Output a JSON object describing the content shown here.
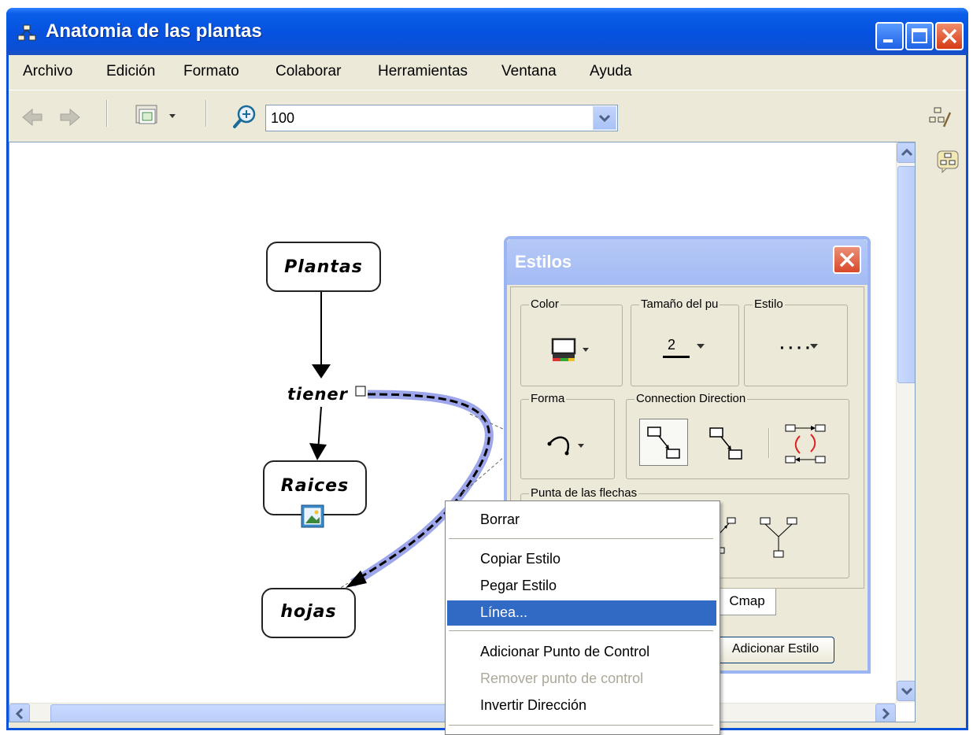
{
  "window": {
    "title": "Anatomia de las plantas"
  },
  "menu": [
    "Archivo",
    "Edición",
    "Formato",
    "Colaborar",
    "Herramientas",
    "Ventana",
    "Ayuda"
  ],
  "toolbar": {
    "zoom_value": "100"
  },
  "concept_map": {
    "nodes": [
      "Plantas",
      "Raices",
      "hojas"
    ],
    "link_label": "tiener"
  },
  "styles_panel": {
    "title": "Estilos",
    "groups": {
      "color": "Color",
      "size": "Tamaño del pu",
      "style": "Estilo",
      "shape": "Forma",
      "direction": "Connection Direction",
      "arrowheads": "Punta de las flechas"
    },
    "size_value": "2",
    "style_value": "····",
    "tab_cmap": "Cmap",
    "add_style_button": "Adicionar Estilo"
  },
  "context_menu": {
    "items": [
      {
        "label": "Borrar",
        "state": "normal"
      },
      {
        "label": "Copiar Estilo",
        "state": "normal"
      },
      {
        "label": "Pegar Estilo",
        "state": "normal"
      },
      {
        "label": "Línea...",
        "state": "selected"
      },
      {
        "label": "Adicionar Punto de Control",
        "state": "normal"
      },
      {
        "label": "Remover punto de control",
        "state": "disabled"
      },
      {
        "label": "Invertir Dirección",
        "state": "normal"
      }
    ]
  },
  "colors": {
    "title_bar": "#0553e0",
    "menu_highlight": "#316ac5",
    "selected_link": "#8d97e8",
    "panel_title": "#a4bbf4"
  }
}
